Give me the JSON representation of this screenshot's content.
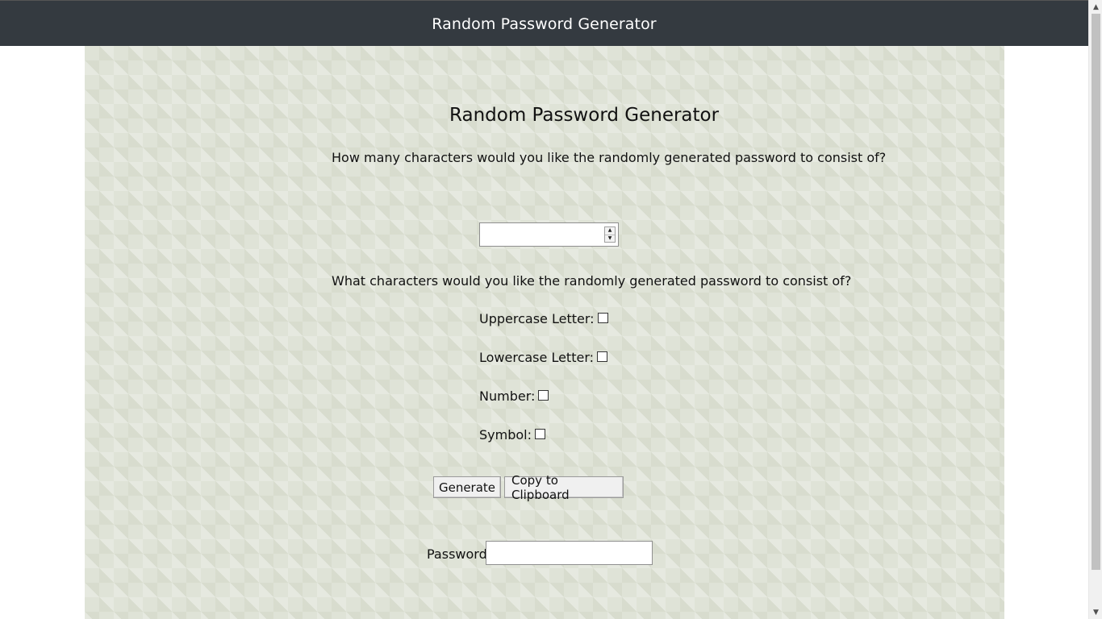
{
  "header": {
    "title": "Random Password Generator"
  },
  "main": {
    "heading": "Random Password Generator",
    "length_question": "How many characters would you like the randomly generated password to consist of?",
    "length_value": "",
    "types_question": "What characters would you like the randomly generated password to consist of?",
    "options": [
      {
        "label": "Uppercase Letter:",
        "checked": false
      },
      {
        "label": "Lowercase Letter:",
        "checked": false
      },
      {
        "label": "Number:",
        "checked": false
      },
      {
        "label": "Symbol:",
        "checked": false
      }
    ],
    "buttons": {
      "generate": "Generate",
      "copy": "Copy to Clipboard"
    },
    "password_label": "Password:",
    "password_value": ""
  },
  "colors": {
    "navbar": "#343a40",
    "content_background": "#dfe3d7"
  },
  "icons": {
    "spinner_up": "triangle-up",
    "spinner_down": "triangle-down",
    "scroll_up": "caret-up",
    "scroll_down": "caret-down"
  }
}
